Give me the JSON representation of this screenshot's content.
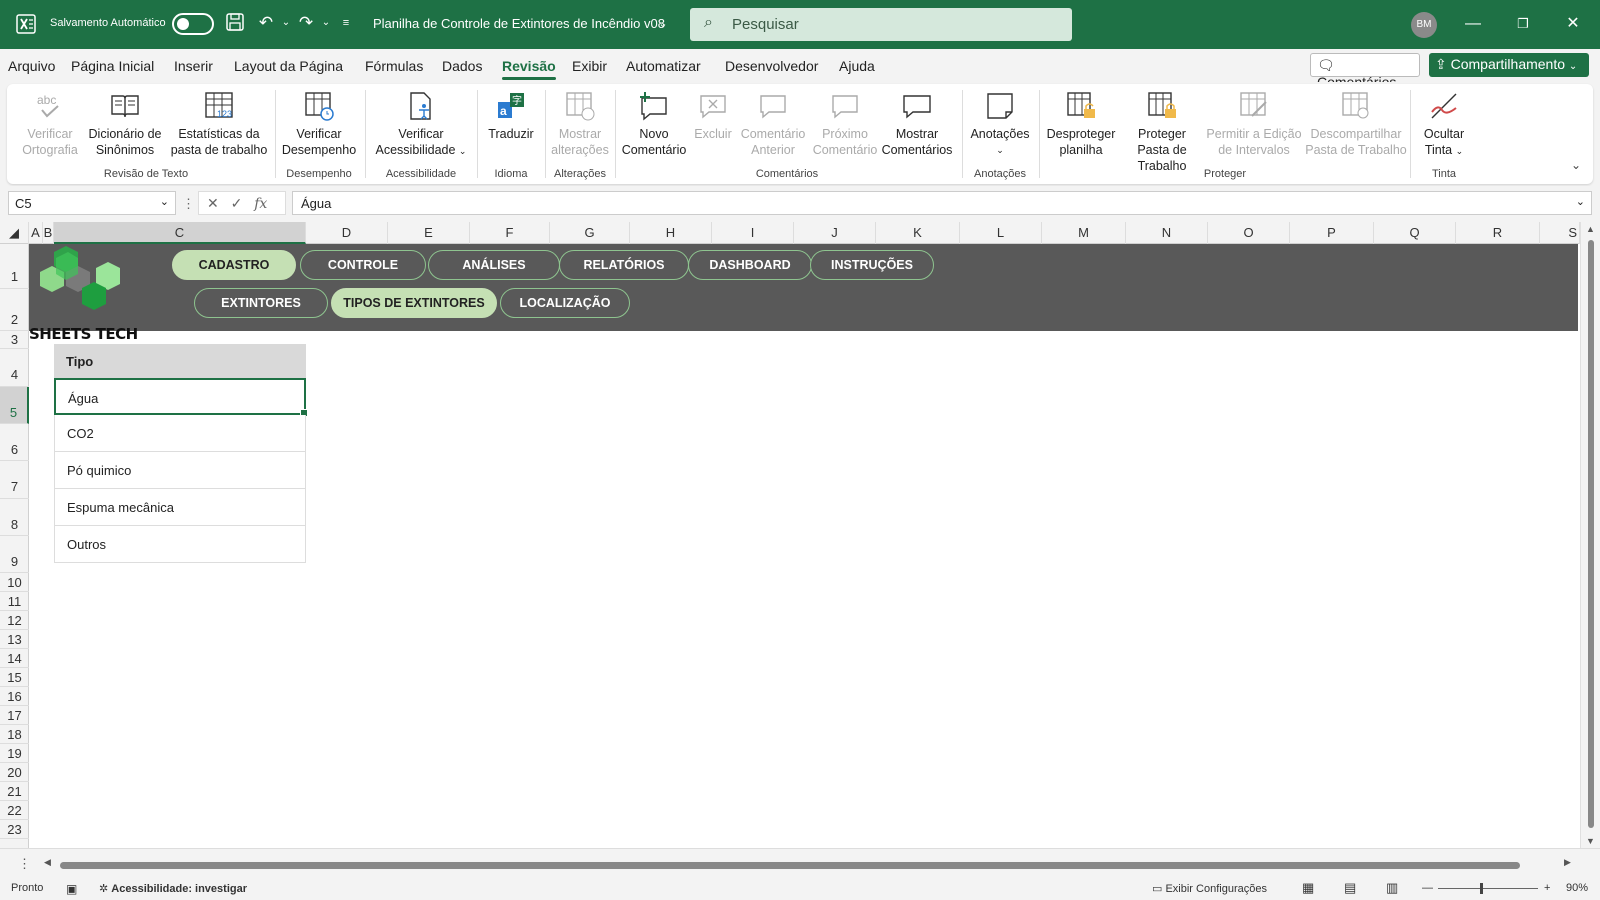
{
  "titlebar": {
    "autosave_label": "Salvamento Automático",
    "doc_title": "Planilha de Controle de Extintores de Incêndio v08",
    "search_placeholder": "Pesquisar",
    "avatar_initials": "BM"
  },
  "menu": {
    "items": [
      "Arquivo",
      "Página Inicial",
      "Inserir",
      "Layout da Página",
      "Fórmulas",
      "Dados",
      "Revisão",
      "Exibir",
      "Automatizar",
      "Desenvolvedor",
      "Ajuda"
    ],
    "active": "Revisão",
    "comments_label": "Comentários",
    "share_label": "Compartilhamento"
  },
  "ribbon": {
    "buttons": {
      "spell": "Verificar Ortografia",
      "thesaurus": "Dicionário de Sinônimos",
      "stats": "Estatísticas da pasta de trabalho",
      "performance": "Verificar Desempenho",
      "accessibility": "Verificar Acessibilidade",
      "translate": "Traduzir",
      "show_changes": "Mostrar alterações",
      "new_comment": "Novo Comentário",
      "delete": "Excluir",
      "prev_comment": "Comentário Anterior",
      "next_comment": "Próximo Comentário",
      "show_comments": "Mostrar Comentários",
      "notes": "Anotações",
      "unprotect_sheet": "Desproteger planilha",
      "protect_workbook": "Proteger Pasta de Trabalho",
      "allow_edit": "Permitir a Edição de Intervalos",
      "unshare": "Descompartilhar Pasta de Trabalho",
      "hide_ink": "Ocultar Tinta"
    },
    "groups": {
      "proofing": "Revisão de Texto",
      "performance": "Desempenho",
      "accessibility": "Acessibilidade",
      "language": "Idioma",
      "changes": "Alterações",
      "comments": "Comentários",
      "notes": "Anotações",
      "protect": "Proteger",
      "ink": "Tinta"
    }
  },
  "formula_bar": {
    "name_box": "C5",
    "formula": "Água"
  },
  "columns": [
    "A",
    "B",
    "C",
    "D",
    "E",
    "F",
    "G",
    "H",
    "I",
    "J",
    "K",
    "L",
    "M",
    "N",
    "O",
    "P",
    "Q",
    "R",
    "S"
  ],
  "rows": [
    "1",
    "2",
    "3",
    "4",
    "5",
    "6",
    "7",
    "8",
    "9",
    "10",
    "11",
    "12",
    "13",
    "14",
    "15",
    "16",
    "17",
    "18",
    "19",
    "20",
    "21",
    "22",
    "23"
  ],
  "sheet": {
    "nav_top": [
      "CADASTRO",
      "CONTROLE",
      "ANÁLISES",
      "RELATÓRIOS",
      "DASHBOARD",
      "INSTRUÇÕES"
    ],
    "nav_bottom": [
      "EXTINTORES",
      "TIPOS DE EXTINTORES",
      "LOCALIZAÇÃO"
    ],
    "brand": "SHEETS TECH",
    "table_header": "Tipo",
    "types": [
      "Água",
      "CO2",
      "Pó quimico",
      "Espuma mecânica",
      "Outros"
    ]
  },
  "status": {
    "ready": "Pronto",
    "accessibility": "Acessibilidade: investigar",
    "display_settings": "Exibir Configurações",
    "zoom": "90%"
  },
  "colors": {
    "excel_green": "#1e7145",
    "banner_gray": "#595959",
    "pill_active": "#c5e0b4"
  }
}
